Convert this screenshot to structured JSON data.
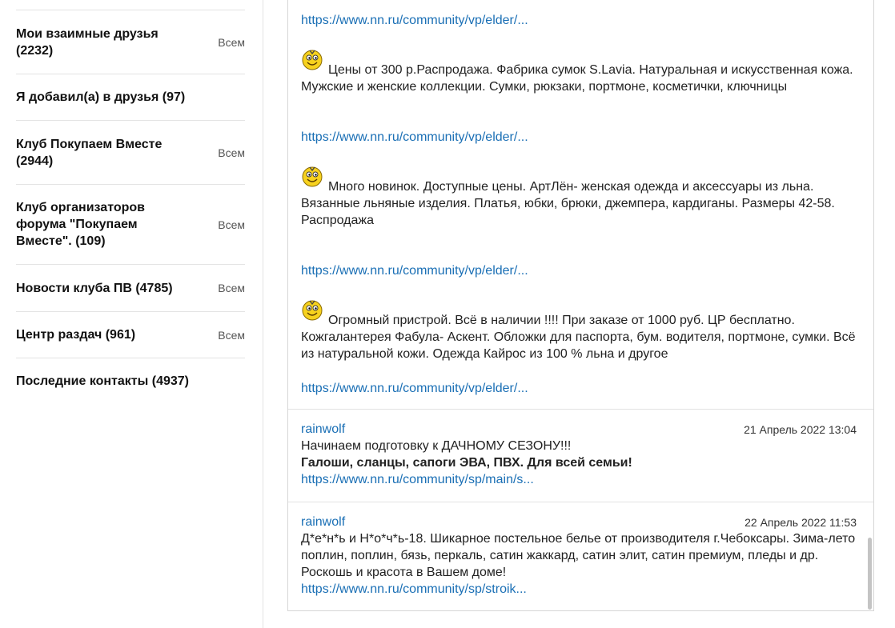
{
  "sidebar": {
    "items": [
      {
        "label": "Мои взаимные друзья (2232)",
        "all": "Всем"
      },
      {
        "label": "Я добавил(а) в друзья (97)",
        "all": ""
      },
      {
        "label": "Клуб Покупаем Вместе (2944)",
        "all": "Всем"
      },
      {
        "label": "Клуб организаторов форума \"Покупаем Вместе\". (109)",
        "all": "Всем"
      },
      {
        "label": "Новости клуба ПВ (4785)",
        "all": "Всем"
      },
      {
        "label": "Центр раздач (961)",
        "all": "Всем"
      },
      {
        "label": "Последние контакты (4937)",
        "all": ""
      }
    ]
  },
  "feed": {
    "link0": "https://www.nn.ru/community/vp/elder/...",
    "ads": [
      {
        "text": "Цены от 300 р.Распродажа. Фабрика сумок S.Lavia. Натуральная и искусственная кожа. Мужские и женские коллекции. Сумки, рюкзаки, портмоне, косметички, ключницы",
        "link": "https://www.nn.ru/community/vp/elder/..."
      },
      {
        "text": "Много новинок. Доступные цены. АртЛён- женская одежда и аксессуары из льна. Вязанные льняные изделия. Платья, юбки, брюки, джемпера, кардиганы. Размеры 42-58. Распродажа",
        "link": "https://www.nn.ru/community/vp/elder/..."
      },
      {
        "text": "Огромный пристрой. Всё в наличии !!!! При заказе от 1000 руб. ЦР бесплатно. Кожгалантерея Фабула- Аскент. Обложки для паспорта, бум. водителя, портмоне, сумки. Всё из натуральной кожи. Одежда Кайрос из 100 % льна и другое",
        "link": "https://www.nn.ru/community/vp/elder/..."
      }
    ],
    "posts": [
      {
        "author": "rainwolf",
        "date": "21 Апрель 2022 13:04",
        "line1": "Начинаем подготовку к ДАЧНОМУ СЕЗОНУ!!!",
        "bold": "Галоши, сланцы, сапоги ЭВА, ПВХ. Для всей семьи!",
        "link": "https://www.nn.ru/community/sp/main/s..."
      },
      {
        "author": "rainwolf",
        "date": "22 Апрель 2022 11:53",
        "text": "Д*е*н*ь и Н*о*ч*ь-18. Шикарное постельное белье от производителя г.Чебоксары. Зима-лето поплин, поплин, бязь, перкаль, сатин жаккард, сатин элит, сатин премиум, пледы и др. Роскошь и красота в Вашем доме!",
        "link": "https://www.nn.ru/community/sp/stroik..."
      }
    ]
  },
  "icons": {
    "smiley": "smiley-face-icon"
  }
}
